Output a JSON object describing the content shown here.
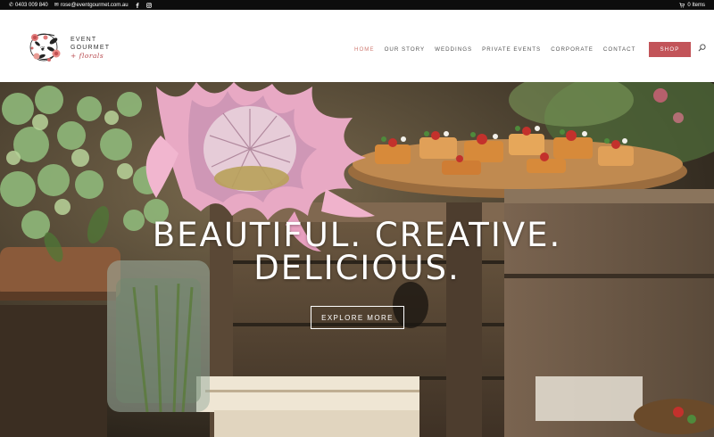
{
  "topbar": {
    "phone": "0403 009 840",
    "email": "rose@eventgourmet.com.au",
    "cart": "0 Items",
    "icons": {
      "phone": "phone-icon",
      "email": "mail-icon",
      "facebook": "facebook-icon",
      "instagram": "instagram-icon",
      "cart": "cart-icon"
    }
  },
  "logo": {
    "line1": "EVENT",
    "line2": "GOURMET",
    "line3": "+ florals"
  },
  "nav": {
    "items": [
      {
        "label": "HOME",
        "active": true
      },
      {
        "label": "OUR STORY"
      },
      {
        "label": "WEDDINGS"
      },
      {
        "label": "PRIVATE EVENTS"
      },
      {
        "label": "CORPORATE"
      },
      {
        "label": "CONTACT"
      }
    ],
    "shop_label": "SHOP",
    "search_icon": "search-icon"
  },
  "hero": {
    "title_line1": "BEAUTIFUL. CREATIVE.",
    "title_line2": "DELICIOUS.",
    "button_label": "EXPLORE MORE"
  },
  "colors": {
    "brand": "#c25459",
    "nav_active": "#d07d74",
    "topbar": "#0d0d0d"
  }
}
